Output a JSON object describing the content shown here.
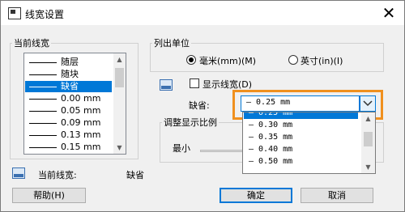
{
  "window": {
    "title": "线宽设置",
    "close_glyph": "✕"
  },
  "current_lineweight_group": {
    "legend": "当前线宽",
    "items": [
      {
        "label": "随层",
        "selected": false
      },
      {
        "label": "随块",
        "selected": false
      },
      {
        "label": "缺省",
        "selected": true
      },
      {
        "label": "0.00 mm",
        "selected": false
      },
      {
        "label": "0.05 mm",
        "selected": false
      },
      {
        "label": "0.09 mm",
        "selected": false
      },
      {
        "label": "0.13 mm",
        "selected": false
      },
      {
        "label": "0.15 mm",
        "selected": false
      }
    ]
  },
  "units_group": {
    "legend": "列出单位",
    "option_mm": "毫米(mm)(M)",
    "option_in": "英寸(in)(I)",
    "selected": "mm"
  },
  "display_lineweight": {
    "label": "显示线宽(D)",
    "checked": false
  },
  "default_combo": {
    "label": "缺省:",
    "value": "— 0.25 mm",
    "options": [
      {
        "label": "— 0.25 mm",
        "selected": true
      },
      {
        "label": "— 0.30 mm",
        "selected": false
      },
      {
        "label": "— 0.35 mm",
        "selected": false
      },
      {
        "label": "— 0.40 mm",
        "selected": false
      },
      {
        "label": "— 0.50 mm",
        "selected": false
      }
    ]
  },
  "scale_group": {
    "legend": "调整显示比例",
    "min_label": "最小"
  },
  "status": {
    "label": "当前线宽:",
    "value": "缺省"
  },
  "buttons": {
    "help": "帮助(H)",
    "ok": "确定",
    "cancel": "取消"
  },
  "colors": {
    "accent": "#0078d7",
    "highlight": "#f0901e"
  }
}
